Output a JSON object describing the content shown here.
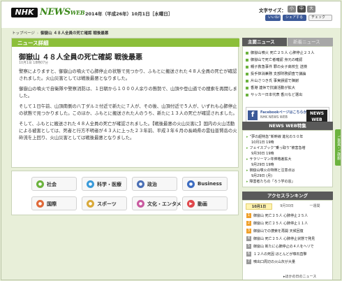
{
  "header": {
    "logo_nhk": "NHK",
    "logo_news": "NEWS",
    "logo_web": "WEB",
    "date": "2014年（平成26年）10月1日［水曜日］",
    "font_size_label": "文字サイズ：",
    "font_small": "小",
    "font_mid": "中",
    "font_large": "大",
    "share_fb": "いいね!",
    "share_btn": "シェアする",
    "share_check": "チェック"
  },
  "breadcrumb": {
    "top": "トップページ",
    "article": "御嶽山 ４８人全員の死亡確認 戦後最悪"
  },
  "article": {
    "section": "ニュース詳細",
    "title": "御嶽山 ４８人全員の死亡確認 戦後最悪",
    "time": "10月1日 18時07分",
    "p1": "警察によりますと、御嶽山の噴火で心肺停止の状態で見つかり、ふもとに搬送された４８人全員の死亡が確認されました。火山災害としては戦後最悪となりました。",
    "p2": "御嶽山の噴火で自衛隊や警察消防は、１日朝から１０００人余りの態勢で、山頂や登山道での捜索を再開しました。",
    "p3": "そして１日午前、山頂南側の八丁ダルミ付近で新たに７人が、その後、山頂付近で５人が、いずれも心肺停止の状態で見つかりました。このほか、ふもとに搬送された人のうち、新たに１３人の死亡が確認されました。",
    "p4": "そして、ふもとに搬送された４８人全員の死亡が確認されました。【戦後最悪の火山災害に】国内の火山活動による被害としては、死者と行方不明者が４３人に上った２３年前、平成３年６月の長崎県の雲仙普賢岳の火砕流を上回り、火山災害としては戦後最悪となりました。"
  },
  "genres": [
    {
      "label": "社会",
      "icon": "society-icon"
    },
    {
      "label": "科学・医療",
      "icon": "science-icon"
    },
    {
      "label": "政治",
      "icon": "politics-icon"
    },
    {
      "label": "Business",
      "icon": "business-icon"
    },
    {
      "label": "国際",
      "icon": "international-icon"
    },
    {
      "label": "スポーツ",
      "icon": "sports-icon"
    },
    {
      "label": "文化・エンタメ",
      "icon": "culture-icon"
    },
    {
      "label": "動画",
      "icon": "video-icon"
    }
  ],
  "sidebar": {
    "tab_main": "主要ニュース",
    "tab_other": "新着ニュース",
    "news": [
      "御嶽山噴火 死亡２５人 心肺停止２３人",
      "御嶽山で死亡者確認 身元の確認",
      "親子救急事件 罪の女子高校生 送検",
      "投手抹消兼務 支部財務調査で議論",
      "片山さつき氏 事実誤認で陳謝",
      "香港 連休で抗議活動が拡大",
      "サッカー日本代表 香川など選出"
    ],
    "fb_text": "Facebookページはこちらから",
    "fb_sub": "NHK NEWS WEB",
    "fb_logo": "NEWS WEB",
    "special_title": "NEWS WEB特集",
    "special": [
      {
        "text": "”夢の超特急”新幹線 進化の５０年",
        "date": "10月1日 19時"
      },
      {
        "text": "フェイスブック”乗っ取り”被害急増",
        "date": "9月30日 19時"
      },
      {
        "text": "サラリーマン年俸格差拡大",
        "date": "9月29日 19時"
      },
      {
        "text": "御嶽山噴火の特徴と注意点は",
        "date": "9月29日 (月)"
      },
      {
        "text": "障害者たちの「ろう学の窓」",
        "date": "9月26日 (金)"
      }
    ],
    "ranking_title": "アクセスランキング",
    "rank_tabs": [
      "10月1日",
      "9月30日",
      "一週間"
    ],
    "ranking": [
      "御嶽山 死亡２５人 心肺停止２５人",
      "御嶽山 死亡２５人 心肺停止１１人",
      "御嶽山での捜索を再開 天候回復",
      "御嶽山 死亡２５人 心肺停止状態で発見",
      "御嶽山 新たに心肺停止の４人をヘリで",
      "１２人の死因 ほとんどが噴石直撃",
      "噴出口周辺の火山灰が大量"
    ],
    "ranking_more": "ほかの日のニュース"
  },
  "feedback_tab": "ご意見・ご感想"
}
